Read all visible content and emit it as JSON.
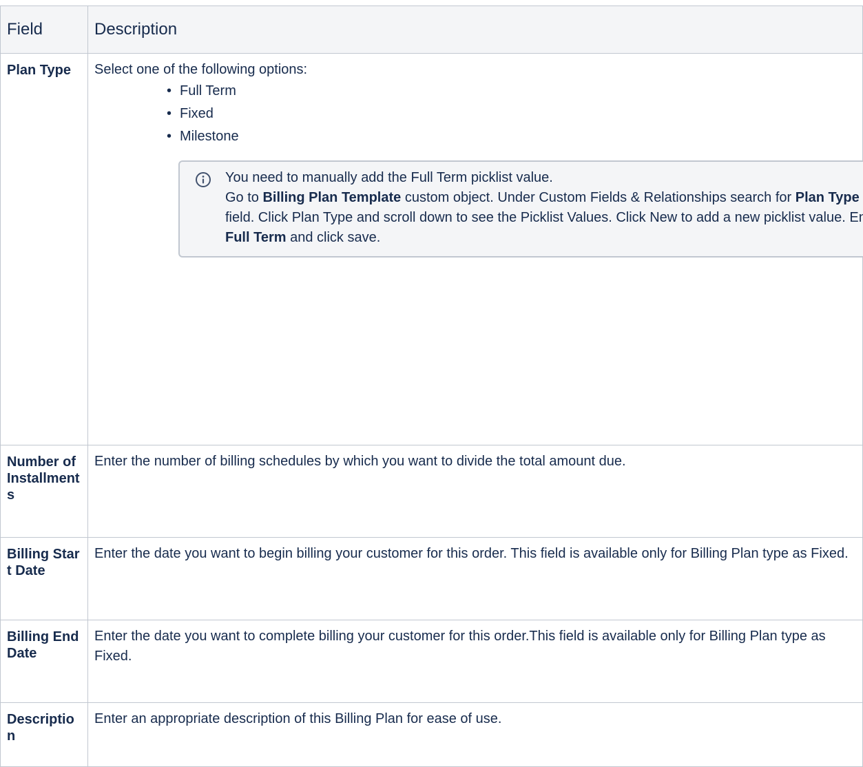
{
  "table": {
    "headers": {
      "field": "Field",
      "description": "Description"
    },
    "rows": [
      {
        "field": "Plan Type",
        "intro": "Select one of the following options:",
        "options": [
          "Full Term",
          "Fixed",
          "Milestone"
        ],
        "note": {
          "icon": "info-icon",
          "line1": "You need to manually add the Full Term picklist value.",
          "p1": "Go to ",
          "b1": "Billing Plan Template",
          "p2": " custom object. Under Custom Fields & Relationships search for ",
          "b2": "Plan Type",
          "p3": " field. Click Plan Type and scroll down to see the Picklist Values. Click New to add a new picklist value. Enter ",
          "b3": "Full Term",
          "p4": " and click save."
        }
      },
      {
        "field": "Number of Installments",
        "description": "Enter the number of billing schedules by which you want to divide the total amount due."
      },
      {
        "field": "Billing Start Date",
        "description": "Enter the date you want to begin billing your customer for this order. This field is available only for Billing Plan type as Fixed."
      },
      {
        "field": "Billing End Date",
        "description": "Enter the date you want to complete billing your customer for this order.This field is available only for Billing Plan type as Fixed."
      },
      {
        "field": "Description",
        "description": "Enter an appropriate description of this Billing Plan for ease of use."
      }
    ]
  },
  "colors": {
    "border": "#c1c7d0",
    "header_bg": "#f4f5f7",
    "text": "#172b4d",
    "info_icon": "#42526e"
  }
}
